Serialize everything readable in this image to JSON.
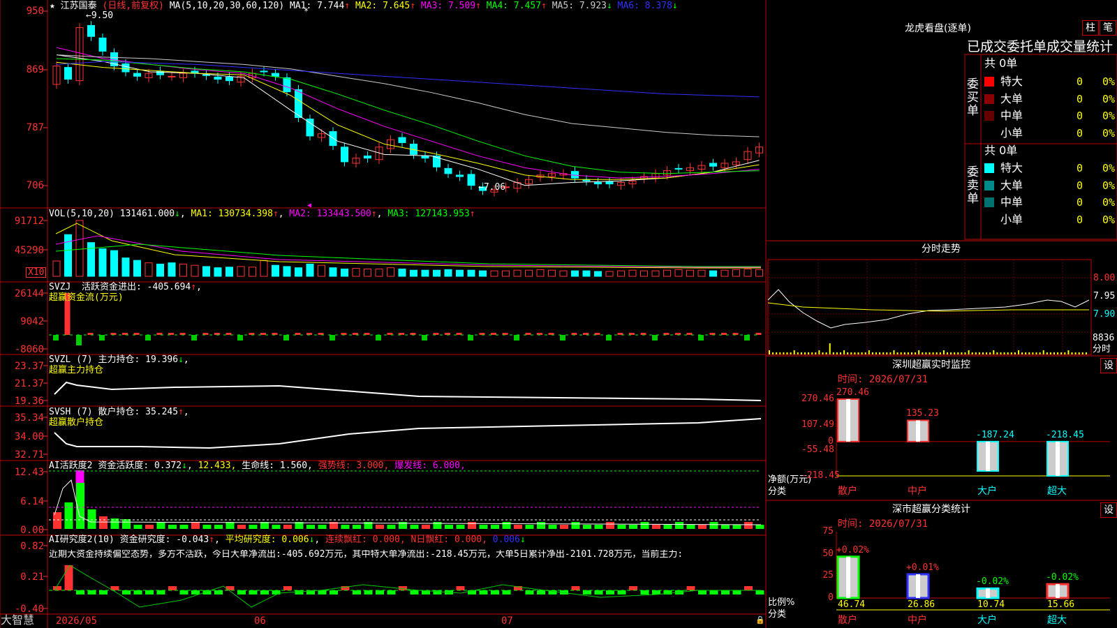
{
  "header": {
    "stock_name": "江苏国泰",
    "mode": "(日线,前复权)",
    "ma_label": "MA(5,10,20,30,60,120)",
    "ma_values": [
      {
        "name": "MA1",
        "value": "7.744",
        "arrow": "↑",
        "color": "#ffffff"
      },
      {
        "name": "MA2",
        "value": "7.645",
        "arrow": "↑",
        "color": "#ffff00"
      },
      {
        "name": "MA3",
        "value": "7.509",
        "arrow": "↑",
        "color": "#ff00ff"
      },
      {
        "name": "MA4",
        "value": "7.457",
        "arrow": "↑",
        "color": "#00ff00"
      },
      {
        "name": "MA5",
        "value": "7.923",
        "arrow": "↓",
        "color": "#cccccc"
      },
      {
        "name": "MA6",
        "value": "8.378",
        "arrow": "↓",
        "color": "#3030ff"
      }
    ]
  },
  "price_panel": {
    "yticks": [
      "950",
      "869",
      "787",
      "706"
    ],
    "high_mark": "9.50",
    "low_mark": "7.06"
  },
  "vol_panel": {
    "label": "VOL(5,10,20)",
    "value": "131461.000",
    "ma1": "130734.398",
    "ma2": "133443.500",
    "ma3": "127143.953",
    "yticks": [
      "91712",
      "45290"
    ],
    "unit": "X10"
  },
  "svzj_panel": {
    "code": "SVZJ",
    "name": "活跃资金进出",
    "value": "-405.694",
    "subtitle": "超赢资金流(万元)",
    "yticks": [
      "26144",
      "9042",
      "-8060"
    ]
  },
  "svzl_panel": {
    "code": "SVZL (7)",
    "name": "主力持仓",
    "value": "19.396",
    "subtitle": "超赢主力持仓",
    "yticks": [
      "23.37",
      "21.37",
      "19.36"
    ]
  },
  "svsh_panel": {
    "code": "SVSH (7)",
    "name": "散户持仓",
    "value": "35.245",
    "subtitle": "超赢散户持仓",
    "yticks": [
      "35.34",
      "34.00",
      "32.71"
    ]
  },
  "ai_active_panel": {
    "code": "AI活跃度2",
    "name": "资金活跃度",
    "value": "0.372",
    "v2": "12.433",
    "life_label": "生命线",
    "life_value": "1.560",
    "strong_label": "强势线",
    "strong_value": "3.000",
    "burst_label": "爆发线",
    "burst_value": "6.000",
    "yticks": [
      "12.43",
      "6.14",
      "0.00"
    ]
  },
  "ai_research_panel": {
    "code": "AI研究度2(10)",
    "name": "资金研究度",
    "value": "-0.043",
    "avg_label": "平均研究度",
    "avg_value": "0.006",
    "lb_label": "连续飘红",
    "lb_value": "0.000",
    "n_label": "N日飘红",
    "n_value": "0.000",
    "last_value": "0.006",
    "comment": "近期大资金持续偏空态势，多方不活跃，今日大单净流出:-405.692万元，其中特大单净流出:-218.45万元，大单5日累计净出-2101.728万元，当前主力:",
    "yticks": [
      "0.82",
      "0.21",
      "-0.40"
    ]
  },
  "bottom_axis": {
    "brand": "大智慧",
    "dates": [
      "2026/05",
      "06",
      "07"
    ]
  },
  "right_panel": {
    "lhb_title": "龙虎看盘(逐单)",
    "btn_zhu": "柱",
    "btn_bi": "笔",
    "stats_title": "已成交委托单成交量统计",
    "buy_label": "委买单",
    "sell_label": "委卖单",
    "buy_total": "共 0单",
    "sell_total": "共 0单",
    "buy_rows": [
      {
        "name": "特大",
        "count": "0",
        "pct": "0%",
        "color": "#ff0000"
      },
      {
        "name": "大单",
        "count": "0",
        "pct": "0%",
        "color": "#8b0000"
      },
      {
        "name": "中单",
        "count": "0",
        "pct": "0%",
        "color": "#660000"
      },
      {
        "name": "小单",
        "count": "0",
        "pct": "0%",
        "color": "#000000"
      }
    ],
    "sell_rows": [
      {
        "name": "特大",
        "count": "0",
        "pct": "0%",
        "color": "#00ffff"
      },
      {
        "name": "大单",
        "count": "0",
        "pct": "0%",
        "color": "#008b8b"
      },
      {
        "name": "中单",
        "count": "0",
        "pct": "0%",
        "color": "#007070"
      },
      {
        "name": "小单",
        "count": "0",
        "pct": "0%",
        "color": "#000000"
      }
    ],
    "fs_title": "分时走势",
    "fs_yticks": [
      "8.00",
      "7.95",
      "7.90"
    ],
    "fs_vol": "8836",
    "fs_vol_unit": "分时",
    "sz_title": "深圳超赢实时监控",
    "sz_set": "设",
    "sz_time": "时间: 2026/07/31",
    "sz_yticks": [
      "270.46",
      "107.49",
      "0",
      "-55.48",
      "-218.45"
    ],
    "sz_ylabel": "净额(万元)",
    "sz_xlabel": "分类",
    "sc_title": "深市超赢分类统计",
    "sc_set": "设",
    "sc_time": "时间: 2026/07/31",
    "sc_yticks": [
      "75",
      "50",
      "25",
      "0"
    ],
    "sc_ylabel": "比例%",
    "sc_xlabel": "分类"
  },
  "chart_data": [
    {
      "type": "bar",
      "title": "深圳超赢实时监控",
      "ylabel": "净额(万元)",
      "xlabel": "分类",
      "categories": [
        "散户",
        "中户",
        "大户",
        "超大"
      ],
      "values": [
        270.46,
        135.23,
        -187.24,
        -218.45
      ],
      "value_labels": [
        "270.46",
        "135.23",
        "-187.24",
        "-218.45"
      ],
      "ylim": [
        -218.45,
        270.46
      ]
    },
    {
      "type": "bar",
      "title": "深市超赢分类统计",
      "ylabel": "比例%",
      "xlabel": "分类",
      "categories": [
        "散户",
        "中户",
        "大户",
        "超大"
      ],
      "values": [
        46.74,
        26.86,
        10.74,
        15.66
      ],
      "value_labels": [
        "46.74",
        "26.86",
        "10.74",
        "15.66"
      ],
      "change_labels": [
        "+0.02%",
        "+0.01%",
        "-0.02%",
        "-0.02%"
      ],
      "ylim": [
        0,
        75
      ]
    }
  ]
}
